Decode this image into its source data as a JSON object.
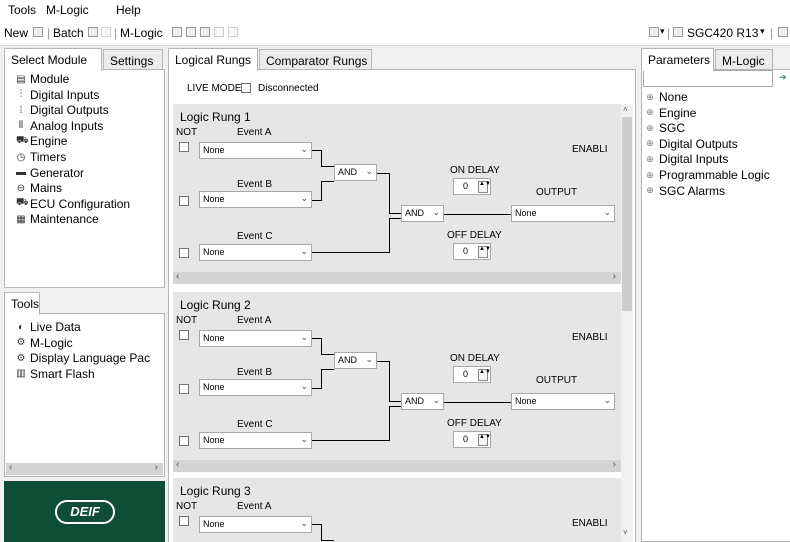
{
  "menu": [
    "Tools",
    "M-Logic",
    "Help"
  ],
  "toolbar": {
    "new": "New",
    "batch": "Batch",
    "mlogic": "M-Logic",
    "controller": "SGC420 R13"
  },
  "left_tabs": [
    "Select Module",
    "Settings"
  ],
  "modules": [
    {
      "label": "Module",
      "icon": "module-icon"
    },
    {
      "label": "Digital Inputs",
      "icon": "digital-inputs-icon"
    },
    {
      "label": "Digital Outputs",
      "icon": "digital-outputs-icon"
    },
    {
      "label": "Analog Inputs",
      "icon": "analog-inputs-icon"
    },
    {
      "label": "Engine",
      "icon": "engine-icon"
    },
    {
      "label": "Timers",
      "icon": "timers-icon"
    },
    {
      "label": "Generator",
      "icon": "generator-icon"
    },
    {
      "label": "Mains",
      "icon": "mains-icon"
    },
    {
      "label": "ECU Configuration",
      "icon": "ecu-icon"
    },
    {
      "label": "Maintenance",
      "icon": "maintenance-icon"
    }
  ],
  "tools_tab": "Tools",
  "tools": [
    {
      "label": "Live Data",
      "icon": "live-data-icon"
    },
    {
      "label": "M-Logic",
      "icon": "mlogic-icon"
    },
    {
      "label": "Display Language Pac",
      "icon": "language-icon"
    },
    {
      "label": "Smart Flash",
      "icon": "smart-flash-icon"
    }
  ],
  "logo": "DEIF",
  "center_tabs": [
    "Logical Rungs",
    "Comparator Rungs"
  ],
  "live_mode": {
    "label": "LIVE MODE",
    "status": "Disconnected"
  },
  "rung_labels": {
    "not": "NOT",
    "event_a": "Event A",
    "event_b": "Event B",
    "event_c": "Event C",
    "enable": "ENABLI",
    "on_delay": "ON DELAY",
    "off_delay": "OFF DELAY",
    "output": "OUTPUT",
    "op": "AND",
    "none": "None",
    "delay_value": "0"
  },
  "rungs": [
    "Logic Rung 1",
    "Logic Rung 2",
    "Logic Rung 3"
  ],
  "right_tabs": [
    "Parameters",
    "M-Logic"
  ],
  "right_tree": [
    "None",
    "Engine",
    "SGC",
    "Digital Outputs",
    "Digital Inputs",
    "Programmable Logic",
    "SGC Alarms"
  ]
}
